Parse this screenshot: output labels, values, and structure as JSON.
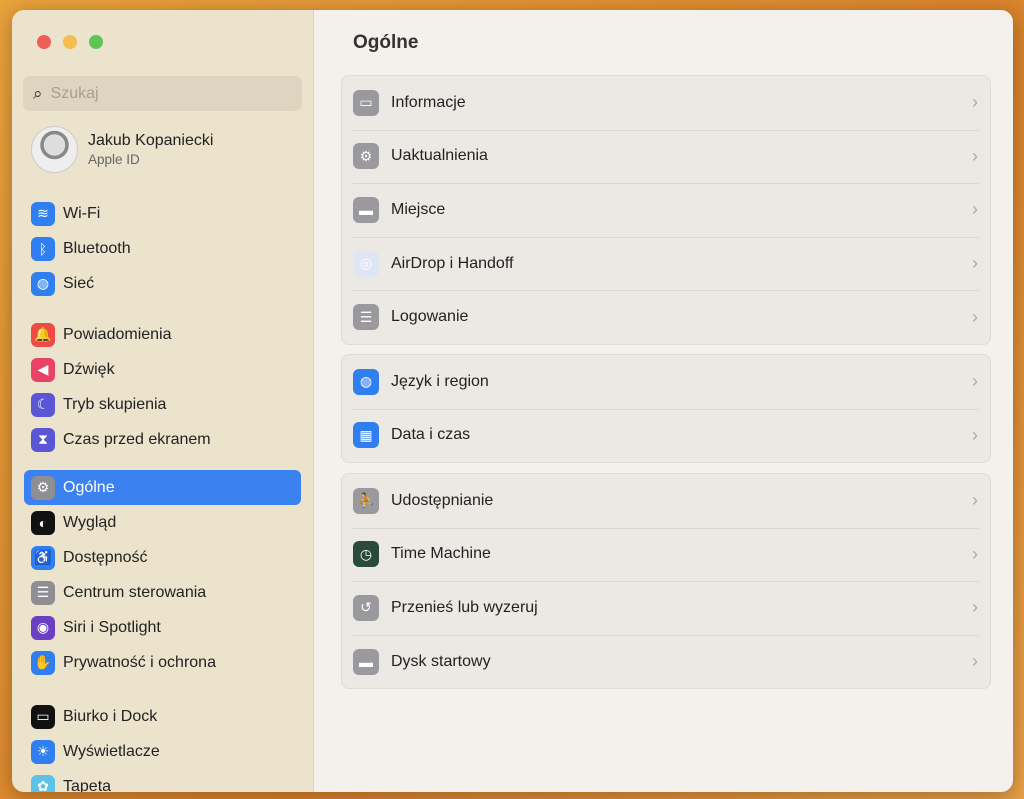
{
  "search": {
    "placeholder": "Szukaj"
  },
  "user": {
    "name": "Jakub Kopaniecki",
    "subtitle": "Apple ID"
  },
  "sidebar": {
    "groups": [
      [
        {
          "label": "Wi-Fi",
          "icon": "wifi-icon",
          "color": "#2f7ff0",
          "glyph": "≋"
        },
        {
          "label": "Bluetooth",
          "icon": "bluetooth-icon",
          "color": "#2f7ff0",
          "glyph": "ᛒ"
        },
        {
          "label": "Sieć",
          "icon": "globe-icon",
          "color": "#2f7ff0",
          "glyph": "◍"
        }
      ],
      [
        {
          "label": "Powiadomienia",
          "icon": "bell-icon",
          "color": "#ef4b45",
          "glyph": "🔔"
        },
        {
          "label": "Dźwięk",
          "icon": "speaker-icon",
          "color": "#e84266",
          "glyph": "◀"
        },
        {
          "label": "Tryb skupienia",
          "icon": "moon-icon",
          "color": "#5a56d6",
          "glyph": "☾"
        },
        {
          "label": "Czas przed ekranem",
          "icon": "hourglass-icon",
          "color": "#5a56d6",
          "glyph": "⧗"
        }
      ],
      [
        {
          "label": "Ogólne",
          "icon": "gear-icon",
          "color": "#8e8e93",
          "glyph": "⚙",
          "active": true
        },
        {
          "label": "Wygląd",
          "icon": "appearance-icon",
          "color": "#111",
          "glyph": "◐"
        },
        {
          "label": "Dostępność",
          "icon": "accessibility-icon",
          "color": "#2f7ff0",
          "glyph": "♿"
        },
        {
          "label": "Centrum sterowania",
          "icon": "toggles-icon",
          "color": "#8e8e93",
          "glyph": "☰"
        },
        {
          "label": "Siri i Spotlight",
          "icon": "siri-icon",
          "color": "#6a3fc4",
          "glyph": "◉"
        },
        {
          "label": "Prywatność i ochrona",
          "icon": "hand-icon",
          "color": "#2f7ff0",
          "glyph": "✋"
        }
      ],
      [
        {
          "label": "Biurko i Dock",
          "icon": "dock-icon",
          "color": "#111",
          "glyph": "▭"
        },
        {
          "label": "Wyświetlacze",
          "icon": "sun-icon",
          "color": "#2f7ff0",
          "glyph": "☀"
        },
        {
          "label": "Tapeta",
          "icon": "wallpaper-icon",
          "color": "#5cc2e8",
          "glyph": "✿"
        }
      ]
    ]
  },
  "main": {
    "title": "Ogólne",
    "groups": [
      [
        {
          "label": "Informacje",
          "icon": "laptop-icon",
          "glyph": "▭"
        },
        {
          "label": "Uaktualnienia",
          "icon": "gear-badge-icon",
          "glyph": "⚙"
        },
        {
          "label": "Miejsce",
          "icon": "drive-icon",
          "glyph": "▬"
        },
        {
          "label": "AirDrop i Handoff",
          "icon": "airdrop-icon",
          "glyph": "◎",
          "color": "#dfe6f3"
        },
        {
          "label": "Logowanie",
          "icon": "list-icon",
          "glyph": "☰"
        }
      ],
      [
        {
          "label": "Język i region",
          "icon": "globe-icon",
          "glyph": "◍",
          "color": "#2f7ff0"
        },
        {
          "label": "Data i czas",
          "icon": "calendar-clock-icon",
          "glyph": "▦",
          "color": "#2f7ff0"
        }
      ],
      [
        {
          "label": "Udostępnianie",
          "icon": "sharing-icon",
          "glyph": "⛹"
        },
        {
          "label": "Time Machine",
          "icon": "time-machine-icon",
          "glyph": "◷",
          "color": "#2b4a3e"
        },
        {
          "label": "Przenieś lub wyzeruj",
          "icon": "reset-icon",
          "glyph": "↺"
        },
        {
          "label": "Dysk startowy",
          "icon": "disk-icon",
          "glyph": "▬"
        }
      ]
    ]
  },
  "colors": {
    "close": "#ed5f57",
    "minimize": "#f4bd4f",
    "zoom": "#5fc454",
    "accent": "#3b82f0"
  }
}
